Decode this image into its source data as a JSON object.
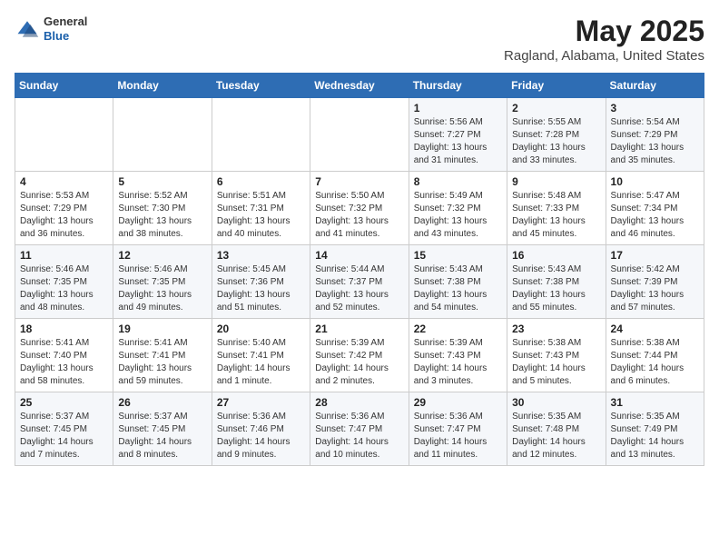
{
  "header": {
    "logo_general": "General",
    "logo_blue": "Blue",
    "title": "May 2025",
    "subtitle": "Ragland, Alabama, United States"
  },
  "days_of_week": [
    "Sunday",
    "Monday",
    "Tuesday",
    "Wednesday",
    "Thursday",
    "Friday",
    "Saturday"
  ],
  "weeks": [
    [
      {
        "day": "",
        "content": ""
      },
      {
        "day": "",
        "content": ""
      },
      {
        "day": "",
        "content": ""
      },
      {
        "day": "",
        "content": ""
      },
      {
        "day": "1",
        "content": "Sunrise: 5:56 AM\nSunset: 7:27 PM\nDaylight: 13 hours\nand 31 minutes."
      },
      {
        "day": "2",
        "content": "Sunrise: 5:55 AM\nSunset: 7:28 PM\nDaylight: 13 hours\nand 33 minutes."
      },
      {
        "day": "3",
        "content": "Sunrise: 5:54 AM\nSunset: 7:29 PM\nDaylight: 13 hours\nand 35 minutes."
      }
    ],
    [
      {
        "day": "4",
        "content": "Sunrise: 5:53 AM\nSunset: 7:29 PM\nDaylight: 13 hours\nand 36 minutes."
      },
      {
        "day": "5",
        "content": "Sunrise: 5:52 AM\nSunset: 7:30 PM\nDaylight: 13 hours\nand 38 minutes."
      },
      {
        "day": "6",
        "content": "Sunrise: 5:51 AM\nSunset: 7:31 PM\nDaylight: 13 hours\nand 40 minutes."
      },
      {
        "day": "7",
        "content": "Sunrise: 5:50 AM\nSunset: 7:32 PM\nDaylight: 13 hours\nand 41 minutes."
      },
      {
        "day": "8",
        "content": "Sunrise: 5:49 AM\nSunset: 7:32 PM\nDaylight: 13 hours\nand 43 minutes."
      },
      {
        "day": "9",
        "content": "Sunrise: 5:48 AM\nSunset: 7:33 PM\nDaylight: 13 hours\nand 45 minutes."
      },
      {
        "day": "10",
        "content": "Sunrise: 5:47 AM\nSunset: 7:34 PM\nDaylight: 13 hours\nand 46 minutes."
      }
    ],
    [
      {
        "day": "11",
        "content": "Sunrise: 5:46 AM\nSunset: 7:35 PM\nDaylight: 13 hours\nand 48 minutes."
      },
      {
        "day": "12",
        "content": "Sunrise: 5:46 AM\nSunset: 7:35 PM\nDaylight: 13 hours\nand 49 minutes."
      },
      {
        "day": "13",
        "content": "Sunrise: 5:45 AM\nSunset: 7:36 PM\nDaylight: 13 hours\nand 51 minutes."
      },
      {
        "day": "14",
        "content": "Sunrise: 5:44 AM\nSunset: 7:37 PM\nDaylight: 13 hours\nand 52 minutes."
      },
      {
        "day": "15",
        "content": "Sunrise: 5:43 AM\nSunset: 7:38 PM\nDaylight: 13 hours\nand 54 minutes."
      },
      {
        "day": "16",
        "content": "Sunrise: 5:43 AM\nSunset: 7:38 PM\nDaylight: 13 hours\nand 55 minutes."
      },
      {
        "day": "17",
        "content": "Sunrise: 5:42 AM\nSunset: 7:39 PM\nDaylight: 13 hours\nand 57 minutes."
      }
    ],
    [
      {
        "day": "18",
        "content": "Sunrise: 5:41 AM\nSunset: 7:40 PM\nDaylight: 13 hours\nand 58 minutes."
      },
      {
        "day": "19",
        "content": "Sunrise: 5:41 AM\nSunset: 7:41 PM\nDaylight: 13 hours\nand 59 minutes."
      },
      {
        "day": "20",
        "content": "Sunrise: 5:40 AM\nSunset: 7:41 PM\nDaylight: 14 hours\nand 1 minute."
      },
      {
        "day": "21",
        "content": "Sunrise: 5:39 AM\nSunset: 7:42 PM\nDaylight: 14 hours\nand 2 minutes."
      },
      {
        "day": "22",
        "content": "Sunrise: 5:39 AM\nSunset: 7:43 PM\nDaylight: 14 hours\nand 3 minutes."
      },
      {
        "day": "23",
        "content": "Sunrise: 5:38 AM\nSunset: 7:43 PM\nDaylight: 14 hours\nand 5 minutes."
      },
      {
        "day": "24",
        "content": "Sunrise: 5:38 AM\nSunset: 7:44 PM\nDaylight: 14 hours\nand 6 minutes."
      }
    ],
    [
      {
        "day": "25",
        "content": "Sunrise: 5:37 AM\nSunset: 7:45 PM\nDaylight: 14 hours\nand 7 minutes."
      },
      {
        "day": "26",
        "content": "Sunrise: 5:37 AM\nSunset: 7:45 PM\nDaylight: 14 hours\nand 8 minutes."
      },
      {
        "day": "27",
        "content": "Sunrise: 5:36 AM\nSunset: 7:46 PM\nDaylight: 14 hours\nand 9 minutes."
      },
      {
        "day": "28",
        "content": "Sunrise: 5:36 AM\nSunset: 7:47 PM\nDaylight: 14 hours\nand 10 minutes."
      },
      {
        "day": "29",
        "content": "Sunrise: 5:36 AM\nSunset: 7:47 PM\nDaylight: 14 hours\nand 11 minutes."
      },
      {
        "day": "30",
        "content": "Sunrise: 5:35 AM\nSunset: 7:48 PM\nDaylight: 14 hours\nand 12 minutes."
      },
      {
        "day": "31",
        "content": "Sunrise: 5:35 AM\nSunset: 7:49 PM\nDaylight: 14 hours\nand 13 minutes."
      }
    ]
  ]
}
